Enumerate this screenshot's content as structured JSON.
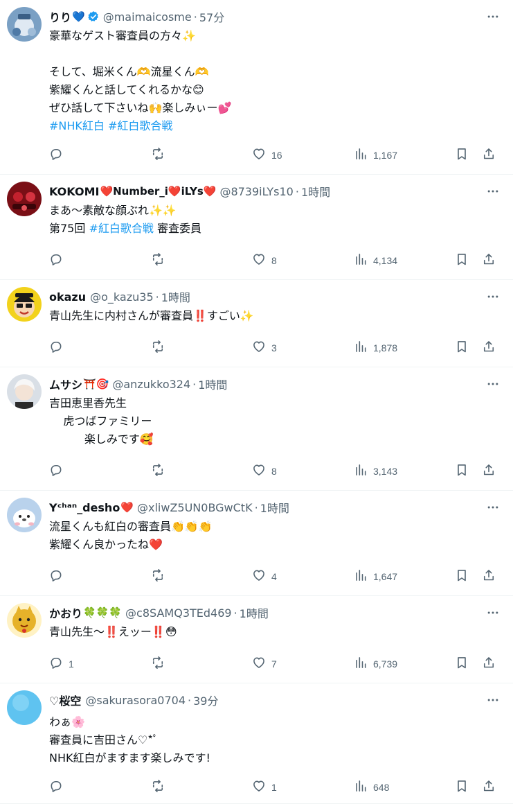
{
  "tweets": [
    {
      "name": "りり",
      "name_emoji": "💙",
      "verified": true,
      "handle": "@maimaicosme",
      "time": "57分",
      "lines": [
        [
          {
            "t": "豪華なゲスト審査員の方々✨"
          }
        ],
        [
          {
            "t": ""
          }
        ],
        [
          {
            "t": "そして、堀米くん🫶流星くん🫶"
          }
        ],
        [
          {
            "t": "紫耀くんと話してくれるかな😊"
          }
        ],
        [
          {
            "t": "ぜひ話して下さいね🙌楽しみぃー💕"
          }
        ],
        [
          {
            "t": "#NHK紅白",
            "tag": true
          },
          {
            "t": " "
          },
          {
            "t": "#紅白歌合戦",
            "tag": true
          }
        ]
      ],
      "replies": "",
      "retweets": "",
      "likes": "16",
      "views": "1,167",
      "avatar_color": "#7aa0c4"
    },
    {
      "name": "KOKOMI",
      "name_emoji": "❤️Number_i❤️iLYs❤️",
      "verified": false,
      "handle": "@8739iLYs10",
      "time": "1時間",
      "lines": [
        [
          {
            "t": "まあ～素敵な顔ぶれ✨✨"
          }
        ],
        [
          {
            "t": "第75回 "
          },
          {
            "t": "#紅白歌合戦",
            "tag": true
          },
          {
            "t": " 審査委員"
          }
        ]
      ],
      "replies": "",
      "retweets": "",
      "likes": "8",
      "views": "4,134",
      "avatar_color": "#7a0f16"
    },
    {
      "name": "okazu",
      "name_emoji": "",
      "verified": false,
      "handle": "@o_kazu35",
      "time": "1時間",
      "lines": [
        [
          {
            "t": "青山先生に内村さんが審査員‼️すごい✨"
          }
        ]
      ],
      "replies": "",
      "retweets": "",
      "likes": "3",
      "views": "1,878",
      "avatar_color": "#f2d21c"
    },
    {
      "name": "ムサシ",
      "name_emoji": "⛩️🎯",
      "verified": false,
      "handle": "@anzukko324",
      "time": "1時間",
      "lines": [
        [
          {
            "t": "吉田恵里香先生"
          }
        ],
        [
          {
            "t": "    虎つばファミリー"
          }
        ],
        [
          {
            "t": "          楽しみです🥰"
          }
        ]
      ],
      "replies": "",
      "retweets": "",
      "likes": "8",
      "views": "3,143",
      "avatar_color": "#d9dfe6"
    },
    {
      "name": "Yᶜʰᵃⁿ_desho",
      "name_emoji": "❤️",
      "verified": false,
      "handle": "@xliwZ5UN0BGwCtK",
      "time": "1時間",
      "lines": [
        [
          {
            "t": "流星くんも紅白の審査員👏👏👏"
          }
        ],
        [
          {
            "t": "紫耀くん良かったね❤️"
          }
        ]
      ],
      "replies": "",
      "retweets": "",
      "likes": "4",
      "views": "1,647",
      "avatar_color": "#b9d2ec"
    },
    {
      "name": "かおり",
      "name_emoji": "🍀🍀🍀",
      "verified": false,
      "handle": "@c8SAMQ3TEd469",
      "time": "1時間",
      "lines": [
        [
          {
            "t": "青山先生～‼️えッー‼️😳"
          }
        ]
      ],
      "replies": "1",
      "retweets": "",
      "likes": "7",
      "views": "6,739",
      "avatar_color": "#e6b22a"
    },
    {
      "name": "♡桜空",
      "name_emoji": "",
      "verified": false,
      "handle": "@sakurasora0704",
      "time": "39分",
      "lines": [
        [
          {
            "t": "わぁ🌸"
          }
        ],
        [
          {
            "t": "審査員に吉田さん♡*ﾟ"
          }
        ],
        [
          {
            "t": "NHK紅白がますます楽しみです!"
          }
        ]
      ],
      "replies": "",
      "retweets": "",
      "likes": "1",
      "views": "648",
      "avatar_color": "#5fc3f0"
    }
  ],
  "icons": {
    "reply": "reply-icon",
    "retweet": "retweet-icon",
    "like": "heart-icon",
    "views": "views-chart-icon",
    "bookmark": "bookmark-icon",
    "share": "share-icon",
    "more": "more-dots-icon",
    "verified": "verified-badge-icon"
  },
  "colors": {
    "text": "#0f1419",
    "secondary": "#536471",
    "link": "#1d9bf0",
    "verified": "#1d9bf0",
    "divider": "#eff3f4"
  }
}
